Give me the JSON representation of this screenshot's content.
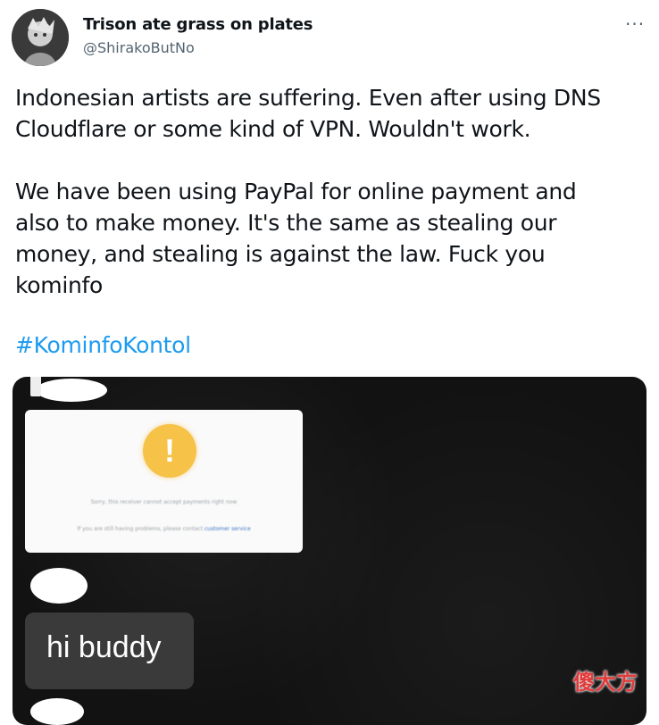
{
  "tweet": {
    "display_name": "Trison ate grass on plates",
    "handle": "@ShirakoButNo",
    "more_icon": "···",
    "text": "Indonesian artists are suffering. Even after using DNS\nCloudflare or some kind of VPN. Wouldn't work.\n\nWe have been using PayPal for online payment and\nalso to make money. It's the same as stealing our\nmoney, and stealing is against the law. Fuck you\nkominfo",
    "hashtag": "#KominfoKontol"
  },
  "media": {
    "dialog": {
      "icon": "!",
      "line1": "Sorry, this receiver cannot accept payments right now",
      "line2_prefix": "If you are still having problems, please contact",
      "line2_link": "customer service"
    },
    "chat_message": "hi buddy"
  },
  "colors": {
    "link": "#1d9bf0",
    "warning": "#f6c248"
  }
}
